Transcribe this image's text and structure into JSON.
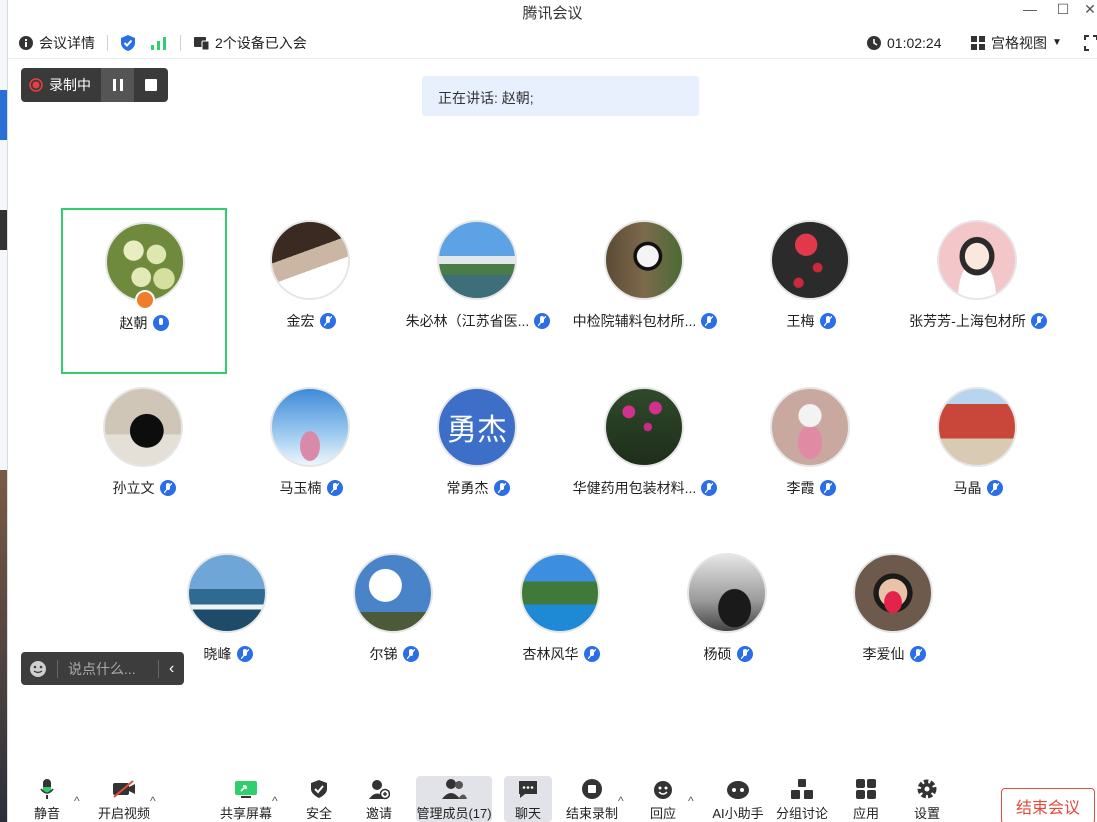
{
  "window": {
    "title": "腾讯会议"
  },
  "infobar": {
    "meeting_details": "会议详情",
    "devices_joined": "2个设备已入会",
    "elapsed": "01:02:24",
    "view_mode": "宫格视图"
  },
  "recording": {
    "status": "录制中"
  },
  "speaking": {
    "text": "正在讲话: 赵朝;"
  },
  "participants": [
    {
      "name": "赵朝"
    },
    {
      "name": "金宏"
    },
    {
      "name": "朱必林（江苏省医..."
    },
    {
      "name": "中检院辅料包材所..."
    },
    {
      "name": "王梅"
    },
    {
      "name": "张芳芳-上海包材所"
    },
    {
      "name": "孙立文"
    },
    {
      "name": "马玉楠"
    },
    {
      "name": "常勇杰",
      "avatar_text": "勇杰"
    },
    {
      "name": "华健药用包装材料..."
    },
    {
      "name": "李霞"
    },
    {
      "name": "马晶"
    },
    {
      "name": "晓峰"
    },
    {
      "name": "尔锑"
    },
    {
      "name": "杏林风华"
    },
    {
      "name": "杨硕"
    },
    {
      "name": "李爱仙"
    }
  ],
  "chat": {
    "placeholder": "说点什么..."
  },
  "toolbar": {
    "mute": "静音",
    "video": "开启视频",
    "share": "共享屏幕",
    "security": "安全",
    "invite": "邀请",
    "members": "管理成员(17)",
    "chat": "聊天",
    "stop_record": "结束录制",
    "react": "回应",
    "ai": "AI小助手",
    "breakout": "分组讨论",
    "apps": "应用",
    "settings": "设置",
    "end_meeting": "结束会议"
  },
  "colors": {
    "accent": "#2a6fe8",
    "active_border": "#2fcf6e",
    "end": "#e8493d",
    "signal": "#2fcf6e"
  }
}
